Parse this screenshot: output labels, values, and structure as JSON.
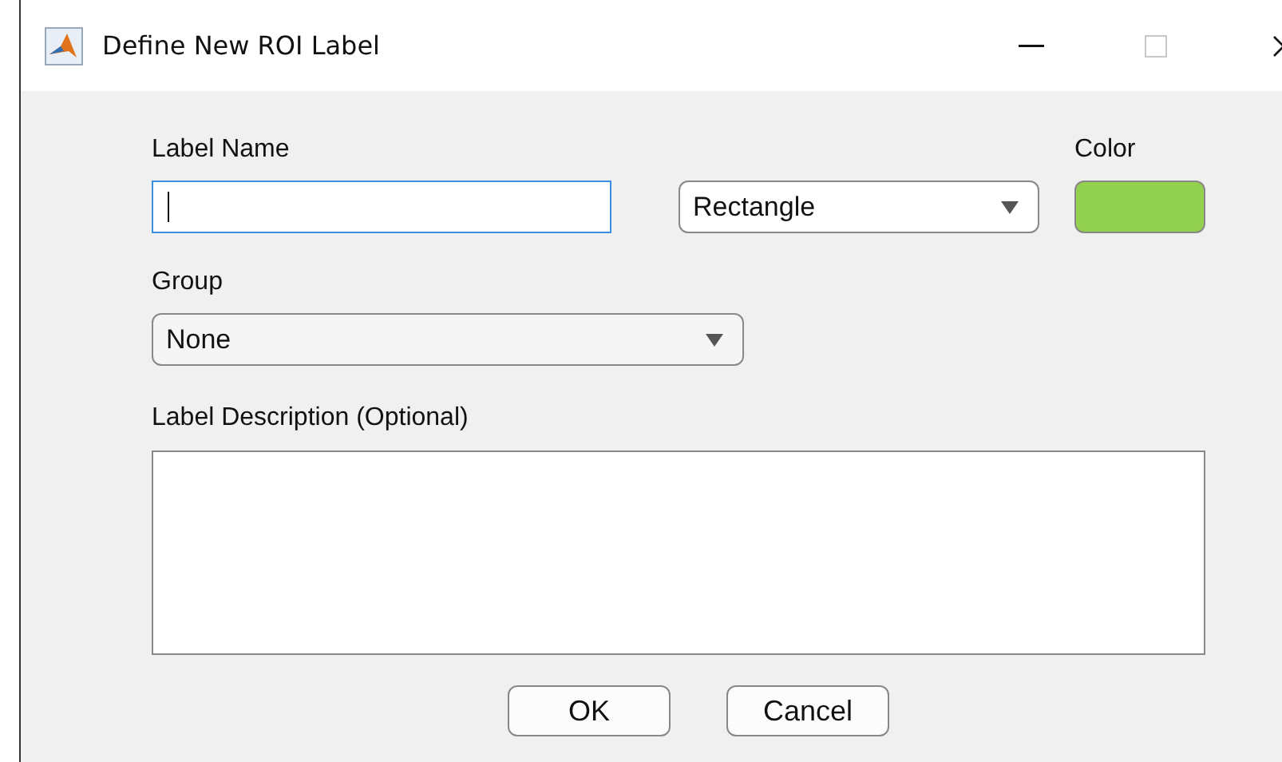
{
  "window": {
    "title": "Define New ROI Label"
  },
  "label_name": {
    "label": "Label Name",
    "focused": true
  },
  "shape": {
    "value": "Rectangle"
  },
  "color": {
    "label": "Color",
    "color": "#92d050"
  },
  "group": {
    "label": "Group",
    "value": "None"
  },
  "description": {
    "label": "Label Description (Optional)"
  },
  "buttons": [
    {
      "label": "OK"
    },
    {
      "label": "Cancel"
    }
  ]
}
